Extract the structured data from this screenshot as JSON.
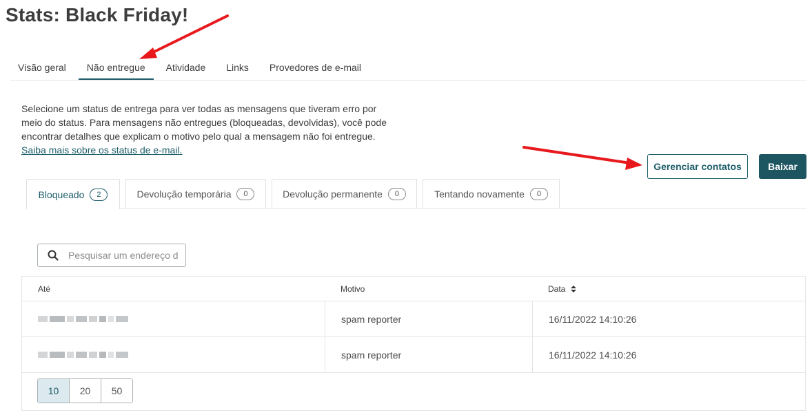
{
  "page": {
    "title": "Stats: Black Friday!"
  },
  "main_tabs": [
    {
      "label": "Visão geral",
      "active": false
    },
    {
      "label": "Não entregue",
      "active": true
    },
    {
      "label": "Atividade",
      "active": false
    },
    {
      "label": "Links",
      "active": false
    },
    {
      "label": "Provedores de e-mail",
      "active": false
    }
  ],
  "description": {
    "text": "Selecione um status de entrega para ver todas as mensagens que tiveram erro por meio do status. Para mensagens não entregues (bloqueadas, devolvidas), você pode encontrar detalhes que explicam o motivo pelo qual a mensagem não foi entregue.",
    "link": "Saiba mais sobre os status de e-mail."
  },
  "actions": {
    "manage_contacts": "Gerenciar contatos",
    "download": "Baixar"
  },
  "status_tabs": [
    {
      "label": "Bloqueado",
      "count": "2",
      "active": true
    },
    {
      "label": "Devolução temporária",
      "count": "0",
      "active": false
    },
    {
      "label": "Devolução permanente",
      "count": "0",
      "active": false
    },
    {
      "label": "Tentando novamente",
      "count": "0",
      "active": false
    }
  ],
  "search": {
    "placeholder": "Pesquisar um endereço de e-mail",
    "icon": "search-icon"
  },
  "table": {
    "columns": [
      "Até",
      "Motivo",
      "Data"
    ],
    "sort_icon": "sort-icon",
    "rows": [
      {
        "to": "",
        "reason": "spam reporter",
        "date": "16/11/2022 14:10:26"
      },
      {
        "to": "",
        "reason": "spam reporter",
        "date": "16/11/2022 14:10:26"
      }
    ]
  },
  "pagination": {
    "sizes": [
      "10",
      "20",
      "50"
    ],
    "selected": "10"
  },
  "colors": {
    "accent": "#1c5d69",
    "primary_button": "#1d5560",
    "annotation_arrow": "#e8191d"
  }
}
